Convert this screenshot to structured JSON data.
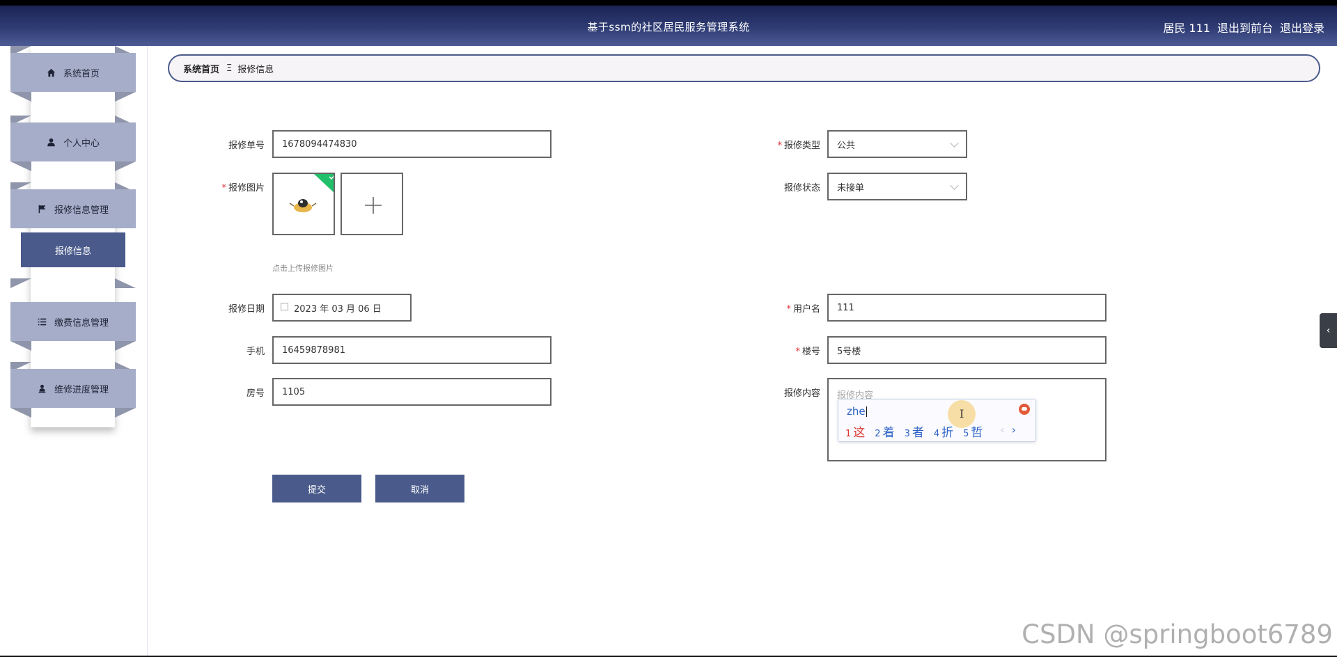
{
  "header": {
    "title": "基于ssm的社区居民服务管理系统",
    "user": "居民 111",
    "front_link": "退出到前台",
    "logout_link": "退出登录"
  },
  "sidebar": {
    "items": [
      {
        "label": "系统首页",
        "icon": "home-icon"
      },
      {
        "label": "个人中心",
        "icon": "user-icon"
      },
      {
        "label": "报修信息管理",
        "icon": "flag-icon"
      },
      {
        "label": "缴费信息管理",
        "icon": "list-icon"
      },
      {
        "label": "维修进度管理",
        "icon": "person-icon"
      }
    ],
    "active_subitem": "报修信息"
  },
  "breadcrumb": {
    "home": "系统首页",
    "separator": "Ξ",
    "current": "报修信息"
  },
  "form": {
    "order_no": {
      "label": "报修单号",
      "value": "1678094474830"
    },
    "repair_type": {
      "label": "报修类型",
      "value": "公共"
    },
    "repair_image": {
      "label": "报修图片",
      "hint": "点击上传报修图片"
    },
    "repair_status": {
      "label": "报修状态",
      "value": "未接单"
    },
    "repair_date": {
      "label": "报修日期",
      "value": "2023 年 03 月 06 日"
    },
    "username": {
      "label": "用户名",
      "value": "111"
    },
    "phone": {
      "label": "手机",
      "value": "16459878981"
    },
    "building": {
      "label": "楼号",
      "value": "5号楼"
    },
    "room": {
      "label": "房号",
      "value": "1105"
    },
    "content": {
      "label": "报修内容",
      "placeholder": "报修内容"
    },
    "submit_label": "提交",
    "cancel_label": "取消"
  },
  "ime": {
    "pinyin": "zhe",
    "candidates": [
      {
        "n": "1",
        "text": "这"
      },
      {
        "n": "2",
        "text": "着"
      },
      {
        "n": "3",
        "text": "者"
      },
      {
        "n": "4",
        "text": "折"
      },
      {
        "n": "5",
        "text": "哲"
      }
    ],
    "prev": "‹",
    "next": "›"
  },
  "side_tab": "‹",
  "watermark": "CSDN @springboot6789",
  "colors": {
    "header_dark": "#1b2353",
    "accent": "#4a5a8b",
    "menu_bg": "#a6adc8",
    "required": "#e0303a",
    "upload_badge": "#22c06a"
  }
}
